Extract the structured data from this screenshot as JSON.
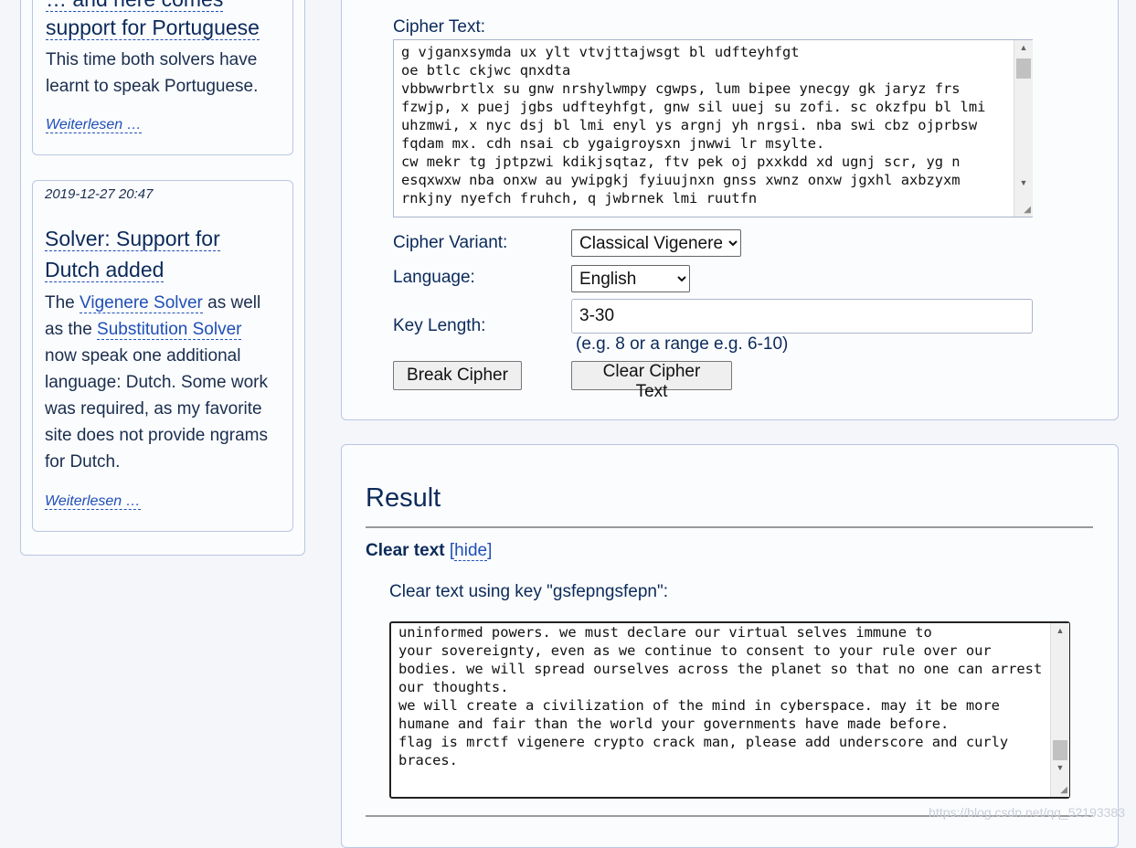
{
  "sidebar": {
    "news_top": {
      "title_line1": "… and here comes",
      "title_line2": "support for Portuguese",
      "body_line1": "This time both solvers have",
      "body_line2": "learnt to speak Portuguese.",
      "read_more": "Weiterlesen …"
    },
    "news_dutch": {
      "date": "2019-12-27 20:47",
      "title_line1": "Solver: Support for",
      "title_line2": "Dutch added",
      "body_prefix": "The",
      "vigenere_link": "Vigenere Solver",
      "body_mid1": "as well",
      "body_mid2": "as the",
      "substitution_link": "Substitution Solver",
      "body_line3": "now speak one additional",
      "body_line4": "language: Dutch. Some work",
      "body_line5": "was required, as my favorite",
      "body_line6": "site does not provide ngrams",
      "body_line7": "for Dutch.",
      "read_more": "Weiterlesen …"
    }
  },
  "form": {
    "cipher_text_label": "Cipher Text:",
    "cipher_text": "g vjganxsymda ux ylt vtvjttajwsgt bl udfteyhfgt\noe btlc ckjwc qnxdta\nvbbwwrbrtlx su gnw nrshylwmpy cgwps, lum bipee ynecgy gk jaryz frs fzwjp, x puej jgbs udfteyhfgt, gnw sil uuej su zofi. sc okzfpu bl lmi uhzmwi, x nyc dsj bl lmi enyl ys argnj yh nrgsi. nba swi cbz ojprbsw fqdam mx. cdh nsai cb ygaigroysxn jnwwi lr msylte.\ncw mekr tg jptpzwi kdikjsqtaz, ftv pek oj pxxkdd xd ugnj scr, yg n esqxwxw nba onxw au ywipgkj fyiuujnxn gnss xwnz onxw jgxhl axbzyxm rnkjny nyefch fruhch, q jwbrnek lmi ruutfn",
    "variant_label": "Cipher Variant:",
    "variant_value": "Classical Vigenere",
    "language_label": "Language:",
    "language_value": "English",
    "key_length_label": "Key Length:",
    "key_length_value": "3-30",
    "key_length_hint": "(e.g. 8 or a range e.g. 6-10)",
    "break_button": "Break Cipher",
    "clear_button": "Clear Cipher Text"
  },
  "result": {
    "title": "Result",
    "clear_text_heading": "Clear text",
    "hide_toggle": "hide",
    "key_line": "Clear text using key \"gsfepngsfepn\":",
    "clear_text": "uninformed powers. we must declare our virtual selves immune to\nyour sovereignty, even as we continue to consent to your rule over our bodies. we will spread ourselves across the planet so that no one can arrest our thoughts.\nwe will create a civilization of the mind in cyberspace. may it be more humane and fair than the world your governments have made before.\nflag is mrctf vigenere crypto crack man, please add underscore and curly braces."
  },
  "watermark": "https://blog.csdn.net/qq_52193383"
}
